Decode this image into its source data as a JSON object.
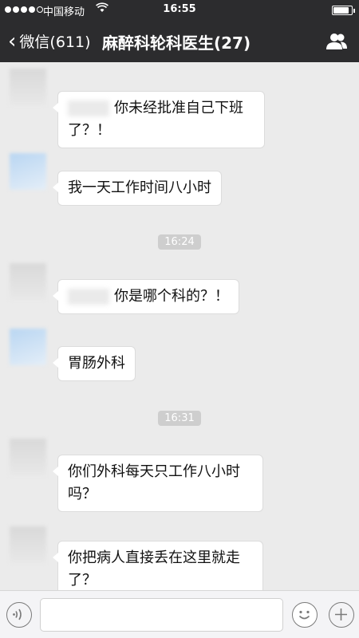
{
  "status_bar": {
    "carrier": "中国移动",
    "time": "16:55",
    "battery_level": 0.85
  },
  "nav": {
    "back_label": "微信(611)",
    "title": "麻醉科轮科医生(27)"
  },
  "messages": [
    {
      "text": "你未经批准自己下班",
      "text2": "了？！",
      "has_redacted_mention": true
    },
    {
      "text": "我一天工作时间八小时"
    },
    {
      "timestamp": "16:24"
    },
    {
      "text": "你是哪个科的？！",
      "has_redacted_mention": true
    },
    {
      "text": "胃肠外科"
    },
    {
      "timestamp": "16:31"
    },
    {
      "text": "你们外科每天只工作八小时",
      "text2": "吗？"
    },
    {
      "text": "你把病人直接丢在这里就走",
      "text2": "了？"
    }
  ],
  "input": {
    "value": ""
  }
}
